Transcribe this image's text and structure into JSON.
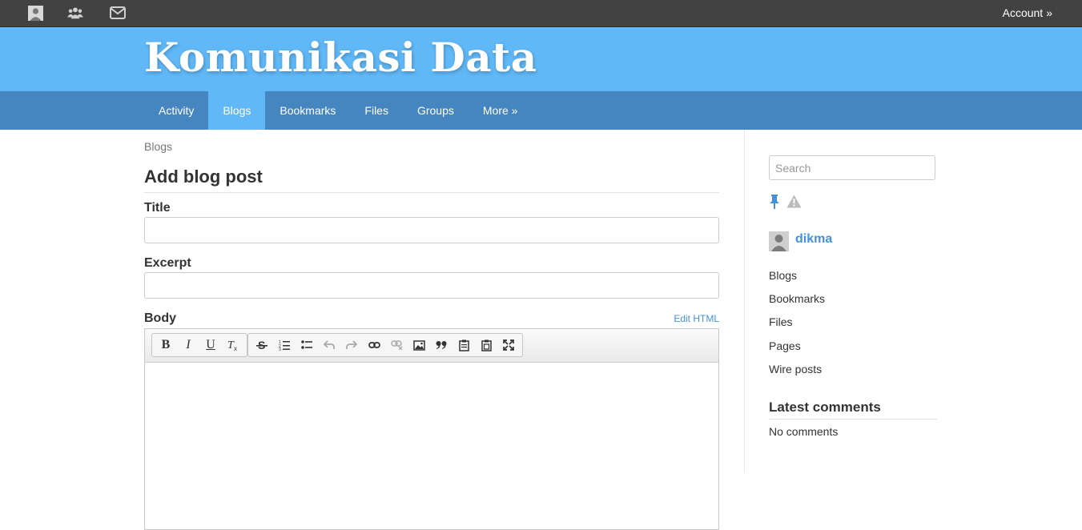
{
  "topbar": {
    "icons": [
      "profile-icon",
      "friends-icon",
      "messages-icon"
    ],
    "account_label": "Account",
    "account_arrow": "»"
  },
  "site": {
    "title": "Komunikasi Data"
  },
  "nav": {
    "items": [
      {
        "label": "Activity"
      },
      {
        "label": "Blogs",
        "active": true
      },
      {
        "label": "Bookmarks"
      },
      {
        "label": "Files"
      },
      {
        "label": "Groups"
      },
      {
        "label": "More »"
      }
    ]
  },
  "main": {
    "breadcrumb": "Blogs",
    "page_title": "Add blog post",
    "title_label": "Title",
    "title_value": "",
    "excerpt_label": "Excerpt",
    "excerpt_value": "",
    "body_label": "Body",
    "edit_html": "Edit HTML",
    "toolbar": {
      "group1": [
        "bold",
        "italic",
        "underline",
        "remove-format"
      ],
      "group2": [
        "strikethrough",
        "numbered-list",
        "bulleted-list",
        "undo",
        "redo",
        "link",
        "unlink",
        "image",
        "blockquote",
        "paste",
        "paste-from-word",
        "maximize"
      ]
    }
  },
  "sidebar": {
    "search_placeholder": "Search",
    "username": "dikma",
    "links": [
      {
        "label": "Blogs"
      },
      {
        "label": "Bookmarks"
      },
      {
        "label": "Files"
      },
      {
        "label": "Pages"
      },
      {
        "label": "Wire posts"
      }
    ],
    "latest_comments_title": "Latest comments",
    "latest_comments_empty": "No comments"
  },
  "colors": {
    "topbar": "#424242",
    "header": "#60b8f7",
    "nav": "#4686c0",
    "nav_active": "#60b8f7",
    "link": "#4690d6"
  }
}
